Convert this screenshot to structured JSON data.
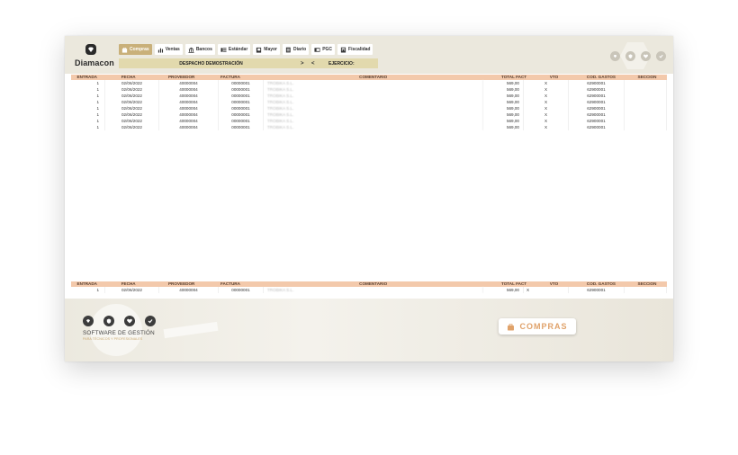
{
  "app": {
    "logo_text": "Diamacon"
  },
  "toolbar": [
    {
      "label": "Compras",
      "icon": "bag-icon",
      "active": true
    },
    {
      "label": "Ventas",
      "icon": "bar-chart-icon"
    },
    {
      "label": "Bancos",
      "icon": "bank-icon"
    },
    {
      "label": "Estándar",
      "icon": "list-icon"
    },
    {
      "label": "Mayor",
      "icon": "book-icon"
    },
    {
      "label": "Diario",
      "icon": "journal-icon"
    },
    {
      "label": "PGC",
      "icon": "folder-icon"
    },
    {
      "label": "Fiscalidad",
      "icon": "calculator-icon"
    }
  ],
  "banner": {
    "company": "DESPACHO DEMOSTRACIÓN",
    "next_symbol": ">",
    "prev_symbol": "<",
    "year_label": "EJERCICIO:"
  },
  "columns": [
    "ENTRADA",
    "FECHA",
    "PROVEEDOR",
    "FACTURA",
    "COMENTARIO",
    "TOTAL FACT",
    "VTO",
    "COD. GASTOS",
    "SECCION"
  ],
  "rows": [
    {
      "entrada": "1",
      "fecha": "02/06/2022",
      "proveedor": "40000004",
      "factura": "00000001",
      "comentario": "TROBIKA S.L.",
      "total": "569,00",
      "vto": "X",
      "cod_gastos": "62900001",
      "seccion": ""
    },
    {
      "entrada": "1",
      "fecha": "02/06/2022",
      "proveedor": "40000004",
      "factura": "00000001",
      "comentario": "TROBIKA S.L.",
      "total": "569,00",
      "vto": "X",
      "cod_gastos": "62900001",
      "seccion": ""
    },
    {
      "entrada": "1",
      "fecha": "02/06/2022",
      "proveedor": "40000004",
      "factura": "00000001",
      "comentario": "TROBIKA S.L.",
      "total": "569,00",
      "vto": "X",
      "cod_gastos": "62900001",
      "seccion": ""
    },
    {
      "entrada": "1",
      "fecha": "02/06/2022",
      "proveedor": "40000004",
      "factura": "00000001",
      "comentario": "TROBIKA S.L.",
      "total": "569,00",
      "vto": "X",
      "cod_gastos": "62900001",
      "seccion": ""
    },
    {
      "entrada": "1",
      "fecha": "02/06/2022",
      "proveedor": "40000004",
      "factura": "00000001",
      "comentario": "TROBIKA S.L.",
      "total": "569,00",
      "vto": "X",
      "cod_gastos": "62900001",
      "seccion": ""
    },
    {
      "entrada": "1",
      "fecha": "02/06/2022",
      "proveedor": "40000004",
      "factura": "00000001",
      "comentario": "TROBIKA S.L.",
      "total": "569,00",
      "vto": "X",
      "cod_gastos": "62900001",
      "seccion": ""
    },
    {
      "entrada": "1",
      "fecha": "02/06/2022",
      "proveedor": "40000004",
      "factura": "00000001",
      "comentario": "TROBIKA S.L.",
      "total": "569,00",
      "vto": "X",
      "cod_gastos": "62900001",
      "seccion": ""
    },
    {
      "entrada": "1",
      "fecha": "02/06/2022",
      "proveedor": "40000004",
      "factura": "00000001",
      "comentario": "TROBIKA S.L.",
      "total": "569,00",
      "vto": "X",
      "cod_gastos": "62900001",
      "seccion": ""
    }
  ],
  "detail_row": {
    "entrada": "1",
    "fecha": "02/06/2022",
    "proveedor": "40000004",
    "factura": "00000001",
    "comentario": "TROBIKA S.L.",
    "total": "569,00",
    "vto": "X",
    "cod_gastos": "62900001",
    "seccion": ""
  },
  "footer": {
    "brand": "SOFTWARE DE GESTIÓN",
    "tagline": "PARA TÉCNICOS Y PROFESIONALES",
    "section_button": "COMPRAS"
  },
  "colors": {
    "accent": "#c9b07a",
    "table_header": "#f3c9ab",
    "banner": "#e2d9ad",
    "compras_text": "#e0a26a"
  }
}
